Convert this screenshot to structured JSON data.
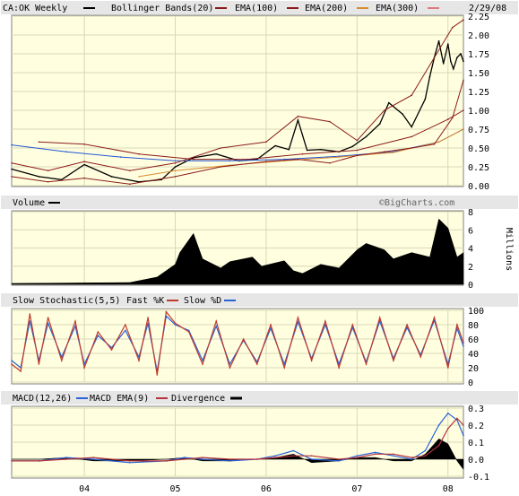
{
  "colors": {
    "price": "#000000",
    "ema100": "#8b1a1a",
    "ema200": "#d98c2e",
    "ema300": "#2455d6",
    "bollinger": "#8b1a1a",
    "stoch_k": "#c0392b",
    "stoch_d": "#2a63d6",
    "macd": "#2a63d6",
    "macd_ema": "#b5323a",
    "divergence": "#000000",
    "panel_bg": "#ffffe0",
    "grid": "#d8d8b8",
    "frame": "#808080"
  },
  "chart_data": [
    {
      "type": "line",
      "panel": "price",
      "legend": [
        "CA:OK Weekly",
        "Bollinger Bands(20)",
        "EMA(100)",
        "EMA(200)",
        "EMA(300)"
      ],
      "date_label": "2/29/08",
      "watermark": "©BigCharts.com",
      "x_tick_labels": [
        "04",
        "05",
        "06",
        "07",
        "08"
      ],
      "x_ticks_years": [
        2004,
        2005,
        2006,
        2007,
        2008
      ],
      "x_range": [
        2003.2,
        2008.17
      ],
      "ylim": [
        0,
        2.25
      ],
      "y_ticks": [
        "2.25",
        "2.00",
        "1.75",
        "1.50",
        "1.25",
        "1.00",
        "0.75",
        "0.50",
        "0.25",
        "0.00"
      ],
      "grid": true,
      "series": [
        {
          "name": "CA:OK Weekly",
          "x": [
            2003.2,
            2003.5,
            2003.75,
            2004.0,
            2004.3,
            2004.6,
            2004.85,
            2005.0,
            2005.2,
            2005.45,
            2005.7,
            2005.9,
            2006.1,
            2006.25,
            2006.35,
            2006.45,
            2006.6,
            2006.8,
            2006.95,
            2007.1,
            2007.25,
            2007.35,
            2007.5,
            2007.6,
            2007.75,
            2007.8,
            2007.85,
            2007.9,
            2007.95,
            2008.0,
            2008.03,
            2008.06,
            2008.1,
            2008.14,
            2008.17
          ],
          "y": [
            0.22,
            0.12,
            0.08,
            0.28,
            0.12,
            0.05,
            0.08,
            0.25,
            0.37,
            0.42,
            0.33,
            0.35,
            0.53,
            0.48,
            0.87,
            0.47,
            0.48,
            0.45,
            0.52,
            0.65,
            0.82,
            1.1,
            0.95,
            0.78,
            1.15,
            1.45,
            1.7,
            1.92,
            1.62,
            1.88,
            1.65,
            1.55,
            1.7,
            1.75,
            1.65
          ]
        },
        {
          "name": "EMA(300)",
          "x": [
            2003.2,
            2003.8,
            2004.4,
            2005.0,
            2005.6,
            2006.2,
            2006.8,
            2007.4,
            2007.9,
            2008.17
          ],
          "y": [
            0.54,
            0.45,
            0.38,
            0.33,
            0.33,
            0.35,
            0.39,
            0.45,
            0.58,
            0.75
          ]
        },
        {
          "name": "EMA(200)",
          "x": [
            2004.6,
            2005.0,
            2005.6,
            2006.2,
            2006.8,
            2007.4,
            2007.9,
            2008.17
          ],
          "y": [
            0.12,
            0.2,
            0.27,
            0.33,
            0.38,
            0.44,
            0.58,
            0.75
          ]
        },
        {
          "name": "EMA(100)",
          "x": [
            2003.5,
            2004.0,
            2004.6,
            2005.2,
            2005.8,
            2006.4,
            2007.0,
            2007.6,
            2008.0,
            2008.17
          ],
          "y": [
            0.58,
            0.55,
            0.42,
            0.35,
            0.35,
            0.42,
            0.47,
            0.65,
            0.88,
            1.0
          ]
        },
        {
          "name": "Bollinger Upper",
          "x": [
            2003.2,
            2003.6,
            2004.0,
            2004.5,
            2005.0,
            2005.5,
            2006.0,
            2006.35,
            2006.7,
            2007.0,
            2007.3,
            2007.6,
            2007.85,
            2008.05,
            2008.17
          ],
          "y": [
            0.3,
            0.2,
            0.32,
            0.2,
            0.3,
            0.5,
            0.58,
            0.92,
            0.85,
            0.6,
            1.0,
            1.2,
            1.7,
            2.1,
            2.2
          ]
        },
        {
          "name": "Bollinger Lower",
          "x": [
            2003.2,
            2003.6,
            2004.0,
            2004.5,
            2005.0,
            2005.5,
            2006.0,
            2006.35,
            2006.7,
            2007.0,
            2007.3,
            2007.6,
            2007.85,
            2008.05,
            2008.17
          ],
          "y": [
            0.12,
            0.05,
            0.1,
            0.02,
            0.12,
            0.25,
            0.32,
            0.35,
            0.3,
            0.4,
            0.45,
            0.5,
            0.55,
            0.9,
            1.4
          ]
        }
      ]
    },
    {
      "type": "area",
      "panel": "volume",
      "legend": [
        "Volume"
      ],
      "ylabel": "Millions",
      "ylim": [
        0,
        8
      ],
      "y_ticks": [
        "8",
        "6",
        "4",
        "2",
        "0"
      ],
      "series": [
        {
          "name": "Volume",
          "x": [
            2003.2,
            2004.5,
            2004.8,
            2005.0,
            2005.05,
            2005.2,
            2005.3,
            2005.5,
            2005.6,
            2005.85,
            2005.95,
            2006.2,
            2006.3,
            2006.4,
            2006.6,
            2006.8,
            2007.0,
            2007.1,
            2007.3,
            2007.4,
            2007.6,
            2007.8,
            2007.9,
            2008.0,
            2008.1,
            2008.17
          ],
          "y": [
            0.1,
            0.2,
            0.8,
            2.2,
            3.5,
            5.6,
            2.8,
            1.8,
            2.5,
            3.0,
            2.0,
            2.6,
            1.5,
            1.2,
            2.2,
            1.8,
            3.8,
            4.5,
            3.8,
            2.8,
            3.5,
            3.0,
            7.2,
            6.2,
            3.0,
            3.5
          ]
        }
      ]
    },
    {
      "type": "line",
      "panel": "stochastic",
      "legend": [
        "Slow Stochastic(5,5)",
        "Fast %K",
        "Slow %D"
      ],
      "ylim": [
        0,
        100
      ],
      "y_ticks": [
        "100",
        "80",
        "60",
        "40",
        "20",
        "0"
      ],
      "series": [
        {
          "name": "Fast %K",
          "x": [
            2003.2,
            2003.3,
            2003.4,
            2003.5,
            2003.6,
            2003.75,
            2003.9,
            2004.0,
            2004.15,
            2004.3,
            2004.45,
            2004.6,
            2004.7,
            2004.8,
            2004.9,
            2005.0,
            2005.15,
            2005.3,
            2005.45,
            2005.6,
            2005.75,
            2005.9,
            2006.05,
            2006.2,
            2006.35,
            2006.5,
            2006.65,
            2006.8,
            2006.95,
            2007.1,
            2007.25,
            2007.4,
            2007.55,
            2007.7,
            2007.85,
            2008.0,
            2008.1,
            2008.17
          ],
          "y": [
            25,
            15,
            95,
            25,
            90,
            30,
            85,
            20,
            70,
            45,
            80,
            30,
            90,
            10,
            98,
            82,
            70,
            25,
            85,
            20,
            60,
            25,
            80,
            20,
            90,
            30,
            85,
            20,
            80,
            25,
            90,
            30,
            80,
            35,
            90,
            20,
            80,
            55
          ]
        },
        {
          "name": "Slow %D",
          "x": [
            2003.2,
            2003.3,
            2003.4,
            2003.5,
            2003.6,
            2003.75,
            2003.9,
            2004.0,
            2004.15,
            2004.3,
            2004.45,
            2004.6,
            2004.7,
            2004.8,
            2004.9,
            2005.0,
            2005.15,
            2005.3,
            2005.45,
            2005.6,
            2005.75,
            2005.9,
            2006.05,
            2006.2,
            2006.35,
            2006.5,
            2006.65,
            2006.8,
            2006.95,
            2007.1,
            2007.25,
            2007.4,
            2007.55,
            2007.7,
            2007.85,
            2008.0,
            2008.1,
            2008.17
          ],
          "y": [
            30,
            20,
            85,
            30,
            82,
            35,
            78,
            25,
            65,
            48,
            72,
            35,
            82,
            15,
            92,
            80,
            72,
            30,
            78,
            25,
            58,
            28,
            75,
            25,
            84,
            33,
            80,
            25,
            76,
            28,
            85,
            33,
            76,
            38,
            86,
            25,
            75,
            50
          ]
        }
      ]
    },
    {
      "type": "line",
      "panel": "macd",
      "legend": [
        "MACD(12,26)",
        "MACD EMA(9)",
        "Divergence"
      ],
      "ylim": [
        -0.1,
        0.3
      ],
      "y_ticks": [
        "0.3",
        "0.2",
        "0.1",
        "0.0",
        "-0.1"
      ],
      "series": [
        {
          "name": "MACD(12,26)",
          "x": [
            2003.2,
            2003.5,
            2003.8,
            2004.1,
            2004.5,
            2004.9,
            2005.1,
            2005.3,
            2005.6,
            2005.9,
            2006.1,
            2006.3,
            2006.5,
            2006.8,
            2007.0,
            2007.2,
            2007.4,
            2007.6,
            2007.75,
            2007.9,
            2008.0,
            2008.1,
            2008.17
          ],
          "y": [
            -0.01,
            -0.01,
            0.01,
            0.0,
            -0.02,
            -0.01,
            0.01,
            0.0,
            -0.01,
            0.0,
            0.02,
            0.05,
            0.0,
            -0.01,
            0.02,
            0.04,
            0.02,
            0.0,
            0.05,
            0.2,
            0.27,
            0.23,
            0.14
          ]
        },
        {
          "name": "MACD EMA(9)",
          "x": [
            2003.2,
            2003.5,
            2003.8,
            2004.1,
            2004.5,
            2004.9,
            2005.1,
            2005.3,
            2005.6,
            2005.9,
            2006.1,
            2006.3,
            2006.5,
            2006.8,
            2007.0,
            2007.2,
            2007.4,
            2007.6,
            2007.75,
            2007.9,
            2008.0,
            2008.1,
            2008.17
          ],
          "y": [
            -0.01,
            -0.01,
            0.0,
            0.01,
            -0.01,
            -0.01,
            0.0,
            0.01,
            0.0,
            0.0,
            0.01,
            0.02,
            0.02,
            0.0,
            0.01,
            0.03,
            0.03,
            0.01,
            0.02,
            0.08,
            0.18,
            0.24,
            0.2
          ]
        },
        {
          "name": "Divergence",
          "x": [
            2003.2,
            2003.5,
            2003.8,
            2004.1,
            2004.5,
            2004.9,
            2005.1,
            2005.3,
            2005.6,
            2005.9,
            2006.1,
            2006.3,
            2006.5,
            2006.8,
            2007.0,
            2007.2,
            2007.4,
            2007.6,
            2007.75,
            2007.9,
            2008.0,
            2008.1,
            2008.17
          ],
          "y": [
            0.0,
            0.0,
            0.01,
            -0.01,
            -0.01,
            0.0,
            0.01,
            -0.01,
            -0.01,
            0.0,
            0.01,
            0.03,
            -0.02,
            -0.01,
            0.01,
            0.01,
            -0.01,
            -0.01,
            0.03,
            0.12,
            0.09,
            -0.01,
            -0.06
          ]
        }
      ]
    }
  ]
}
